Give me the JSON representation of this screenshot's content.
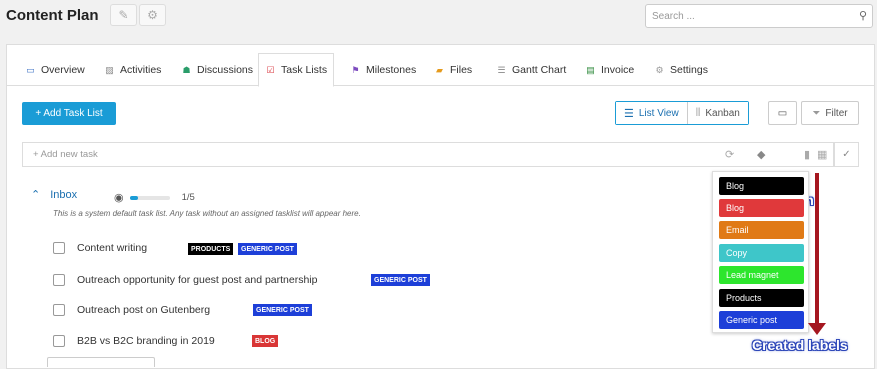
{
  "header": {
    "title": "Content Plan",
    "search_placeholder": "Search ..."
  },
  "tabs": [
    {
      "label": "Overview",
      "icon": "overview-icon",
      "active": false
    },
    {
      "label": "Activities",
      "icon": "activities-icon",
      "active": false
    },
    {
      "label": "Discussions",
      "icon": "discussions-icon",
      "active": false
    },
    {
      "label": "Task Lists",
      "icon": "task-lists-icon",
      "active": true
    },
    {
      "label": "Milestones",
      "icon": "milestones-icon",
      "active": false
    },
    {
      "label": "Files",
      "icon": "files-icon",
      "active": false
    },
    {
      "label": "Gantt Chart",
      "icon": "gantt-chart-icon",
      "active": false
    },
    {
      "label": "Invoice",
      "icon": "invoice-icon",
      "active": false
    },
    {
      "label": "Settings",
      "icon": "settings-icon",
      "active": false
    }
  ],
  "toolbar": {
    "add_task_list": "+ Add Task List",
    "list_view": "List View",
    "kanban": "Kanban",
    "filter": "Filter"
  },
  "new_task": {
    "placeholder": "+ Add new task"
  },
  "inbox": {
    "title": "Inbox",
    "progress_text": "1/5",
    "progress_fraction": 0.2,
    "note": "This is a system default task list. Any task without an assigned tasklist will appear here."
  },
  "tasks": [
    {
      "title": "Content writing",
      "tags": [
        {
          "label": "PRODUCTS",
          "color": "#000000"
        },
        {
          "label": "GENERIC POST",
          "color": "#1d3fd8"
        }
      ]
    },
    {
      "title": "Outreach opportunity for guest post and partnership",
      "tags": [
        {
          "label": "GENERIC POST",
          "color": "#1d3fd8"
        }
      ]
    },
    {
      "title": "Outreach post on Gutenberg",
      "tags": [
        {
          "label": "GENERIC POST",
          "color": "#1d3fd8"
        }
      ]
    },
    {
      "title": "B2B vs B2C branding in 2019",
      "tags": [
        {
          "label": "BLOG",
          "color": "#d93636"
        }
      ]
    }
  ],
  "label_dropdown": [
    {
      "label": "Blog",
      "color": "#000000"
    },
    {
      "label": "Blog",
      "color": "#e0393b"
    },
    {
      "label": "Email",
      "color": "#e07a16"
    },
    {
      "label": "Copy",
      "color": "#3ec6c9"
    },
    {
      "label": "Lead magnet",
      "color": "#2de62d"
    },
    {
      "label": "Products",
      "color": "#000000"
    },
    {
      "label": "Generic post",
      "color": "#1d3fd8"
    }
  ],
  "annotations": {
    "icon_label": "Icon",
    "created_labels": "Created labels",
    "accent": "#a5161f"
  }
}
